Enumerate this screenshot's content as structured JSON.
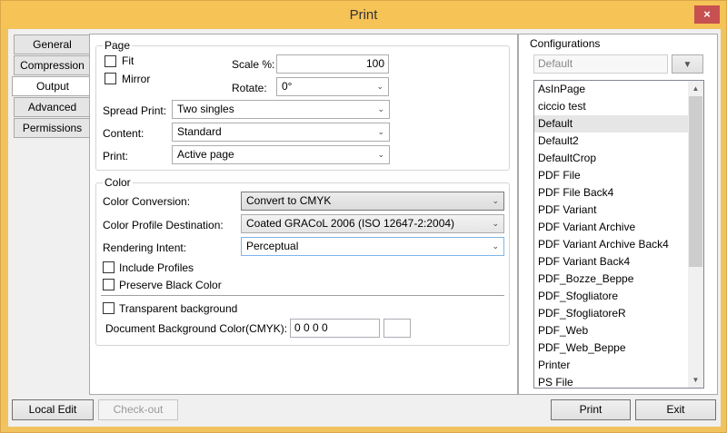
{
  "window": {
    "title": "Print",
    "close_glyph": "×"
  },
  "tabs": [
    {
      "label": "General",
      "active": false
    },
    {
      "label": "Compression",
      "active": false
    },
    {
      "label": "Output",
      "active": true
    },
    {
      "label": "Advanced",
      "active": false
    },
    {
      "label": "Permissions",
      "active": false
    }
  ],
  "page_group": {
    "legend": "Page",
    "fit_label": "Fit",
    "mirror_label": "Mirror",
    "scale_label": "Scale %:",
    "scale_value": "100",
    "rotate_label": "Rotate:",
    "rotate_value": "0°",
    "spread_label": "Spread Print:",
    "spread_value": "Two singles",
    "content_label": "Content:",
    "content_value": "Standard",
    "print_label": "Print:",
    "print_value": "Active page"
  },
  "color_group": {
    "legend": "Color",
    "conversion_label": "Color Conversion:",
    "conversion_value": "Convert to CMYK",
    "profile_label": "Color Profile Destination:",
    "profile_value": "Coated GRACoL 2006 (ISO 12647-2:2004)",
    "intent_label": "Rendering Intent:",
    "intent_value": "Perceptual",
    "include_profiles_label": "Include Profiles",
    "preserve_black_label": "Preserve Black Color",
    "transparent_bg_label": "Transparent background",
    "doc_bg_label": "Document Background Color(CMYK):",
    "doc_bg_value": "0 0 0 0"
  },
  "configurations": {
    "legend": "Configurations",
    "selected_value": "Default",
    "items": [
      "AsInPage",
      "ciccio test",
      "Default",
      "Default2",
      "DefaultCrop",
      "PDF File",
      "PDF File Back4",
      "PDF Variant",
      "PDF Variant Archive",
      "PDF Variant Archive Back4",
      "PDF Variant Back4",
      "PDF_Bozze_Beppe",
      "PDF_Sfogliatore",
      "PDF_SfogliatoreR",
      "PDF_Web",
      "PDF_Web_Beppe",
      "Printer",
      "PS File"
    ],
    "selected_index": 2
  },
  "buttons": {
    "local_edit": "Local Edit",
    "check_out": "Check-out",
    "print": "Print",
    "exit": "Exit"
  },
  "colors": {
    "title_bar": "#f6c356",
    "close_button": "#c75050",
    "highlight_border": "#7eb4ea"
  }
}
